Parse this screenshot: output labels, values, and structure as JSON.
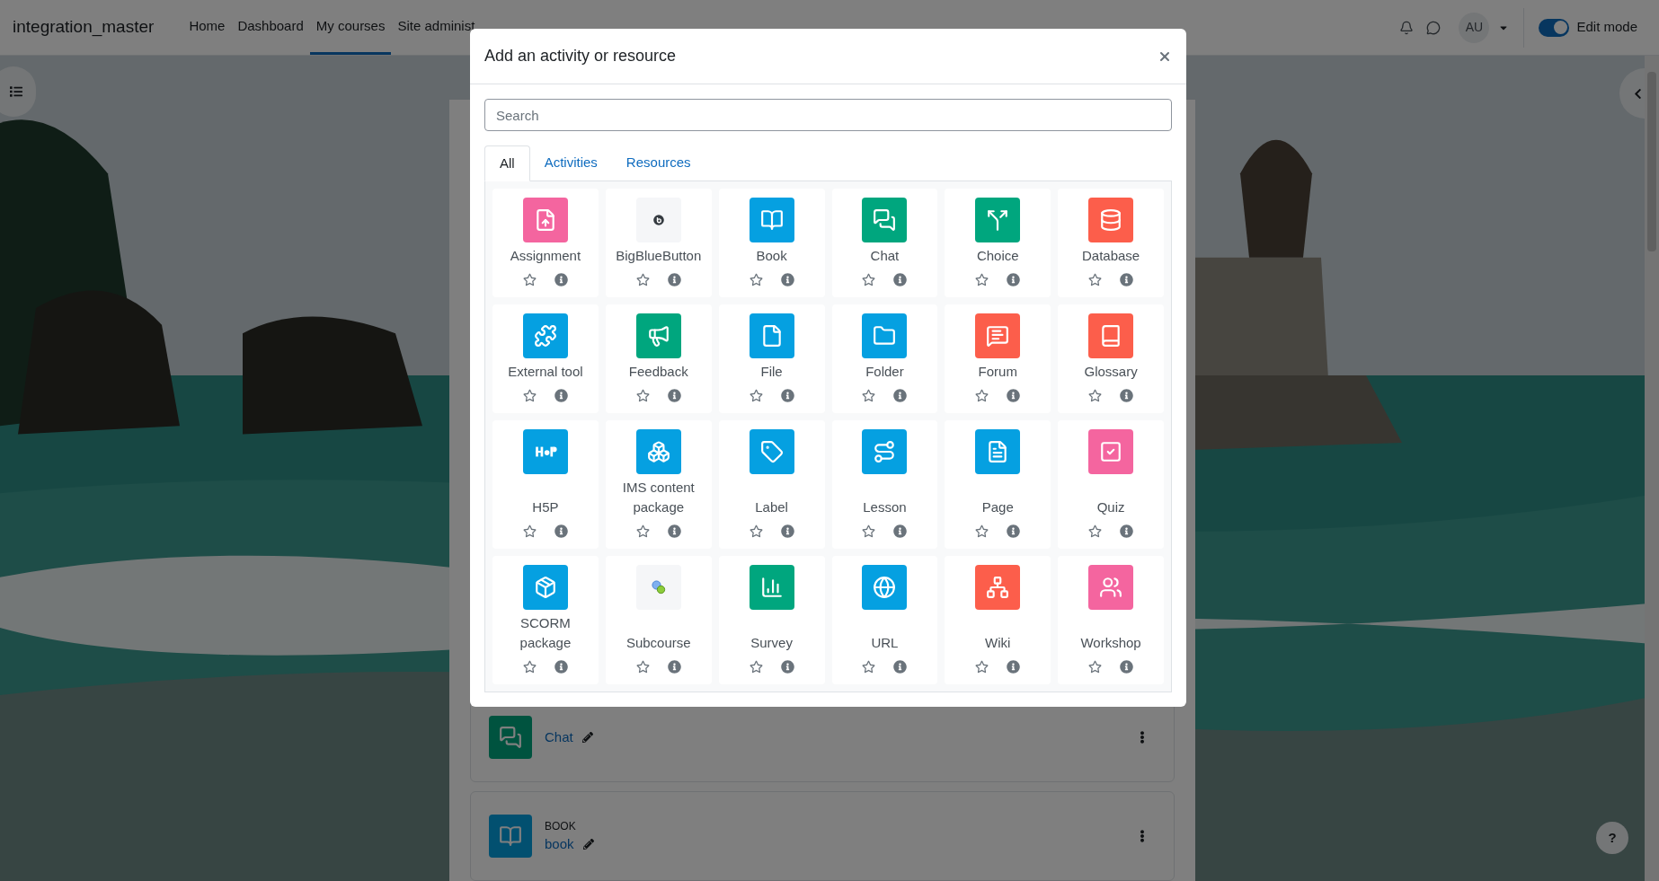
{
  "navbar": {
    "brand": "integration_master",
    "links": [
      {
        "label": "Home",
        "selected": false
      },
      {
        "label": "Dashboard",
        "selected": false
      },
      {
        "label": "My courses",
        "selected": true
      },
      {
        "label": "Site administ",
        "selected": false
      }
    ],
    "user_initials": "AU",
    "edit_mode": {
      "label": "Edit mode",
      "on": true
    }
  },
  "course_items": [
    {
      "name": "Chat"
    },
    {
      "type_label": "BOOK",
      "name": "book"
    }
  ],
  "help_button": "?",
  "modal": {
    "title": "Add an activity or resource",
    "search": {
      "placeholder": "Search"
    },
    "tabs": [
      {
        "label": "All",
        "selected": true
      },
      {
        "label": "Activities",
        "selected": false
      },
      {
        "label": "Resources",
        "selected": false
      }
    ],
    "tiles": [
      {
        "name": "Assignment",
        "color": "#f4659f",
        "starred": false
      },
      {
        "name": "BigBlueButton",
        "color": "#f5f6f8",
        "starred": false
      },
      {
        "name": "Book",
        "color": "#05a0e1",
        "starred": false
      },
      {
        "name": "Chat",
        "color": "#00a67e",
        "starred": false
      },
      {
        "name": "Choice",
        "color": "#00a67e",
        "starred": false
      },
      {
        "name": "Database",
        "color": "#fc5e4b",
        "starred": false
      },
      {
        "name": "External tool",
        "color": "#05a0e1",
        "starred": false
      },
      {
        "name": "Feedback",
        "color": "#00a67e",
        "starred": false
      },
      {
        "name": "File",
        "color": "#05a0e1",
        "starred": false
      },
      {
        "name": "Folder",
        "color": "#05a0e1",
        "starred": false
      },
      {
        "name": "Forum",
        "color": "#fc5e4b",
        "starred": false
      },
      {
        "name": "Glossary",
        "color": "#fc5e4b",
        "starred": false
      },
      {
        "name": "H5P",
        "color": "#05a0e1",
        "starred": false
      },
      {
        "name": "IMS content package",
        "color": "#05a0e1",
        "starred": false
      },
      {
        "name": "Label",
        "color": "#05a0e1",
        "starred": false
      },
      {
        "name": "Lesson",
        "color": "#05a0e1",
        "starred": false
      },
      {
        "name": "Page",
        "color": "#05a0e1",
        "starred": false
      },
      {
        "name": "Quiz",
        "color": "#f4659f",
        "starred": false
      },
      {
        "name": "SCORM package",
        "color": "#05a0e1",
        "starred": false
      },
      {
        "name": "Subcourse",
        "color": "#f5f6f8",
        "starred": false
      },
      {
        "name": "Survey",
        "color": "#00a67e",
        "starred": false
      },
      {
        "name": "URL",
        "color": "#05a0e1",
        "starred": false
      },
      {
        "name": "Wiki",
        "color": "#fc5e4b",
        "starred": false
      },
      {
        "name": "Workshop",
        "color": "#f4659f",
        "starred": false
      }
    ]
  }
}
